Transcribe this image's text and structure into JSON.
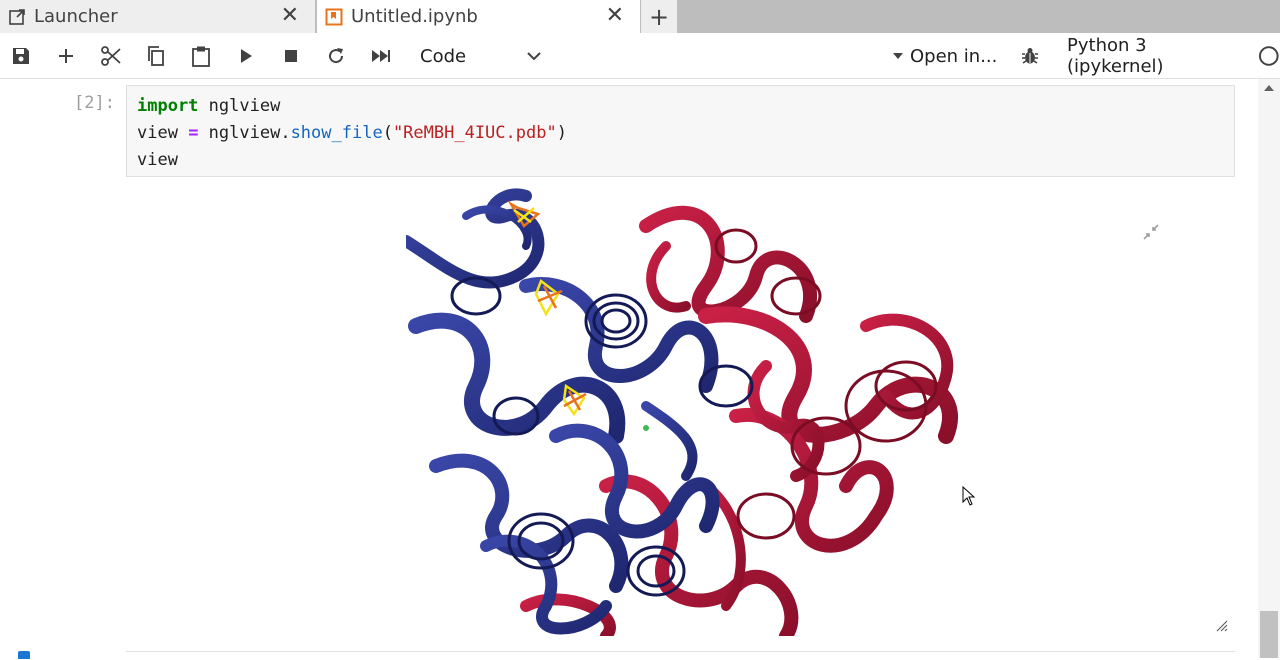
{
  "tabs": [
    {
      "label": "Launcher",
      "icon": "launcher-icon",
      "active": false
    },
    {
      "label": "Untitled.ipynb",
      "icon": "notebook-icon",
      "active": true
    }
  ],
  "new_tab_label": "+",
  "toolbar": {
    "buttons": [
      "save-icon",
      "add-cell-icon",
      "cut-icon",
      "copy-icon",
      "paste-icon",
      "run-icon",
      "stop-icon",
      "restart-icon",
      "run-all-icon"
    ],
    "cell_type": "Code",
    "open_in": "Open in...",
    "kernel_name": "Python 3 (ipykernel)"
  },
  "cell": {
    "prompt": "[2]:",
    "code_lines": [
      [
        {
          "t": "import",
          "c": "kw"
        },
        {
          "t": " nglview",
          "c": ""
        }
      ],
      [
        {
          "t": "view ",
          "c": ""
        },
        {
          "t": "=",
          "c": "op"
        },
        {
          "t": " nglview.",
          "c": ""
        },
        {
          "t": "show_file",
          "c": "fn"
        },
        {
          "t": "(",
          "c": ""
        },
        {
          "t": "\"ReMBH_4IUC.pdb\"",
          "c": "str"
        },
        {
          "t": ")",
          "c": ""
        }
      ],
      [
        {
          "t": "view",
          "c": ""
        }
      ]
    ]
  },
  "output": {
    "widget": "nglview-protein-viewer",
    "colors": {
      "chain_a": "#2e3a8f",
      "chain_b": "#b0173a",
      "ligand_yellow": "#f2e21a",
      "ligand_orange": "#e8731b"
    }
  },
  "colors": {
    "accent": "#1976d2",
    "tab_inactive": "#eeeeee",
    "notebook_icon": "#e8731b"
  }
}
